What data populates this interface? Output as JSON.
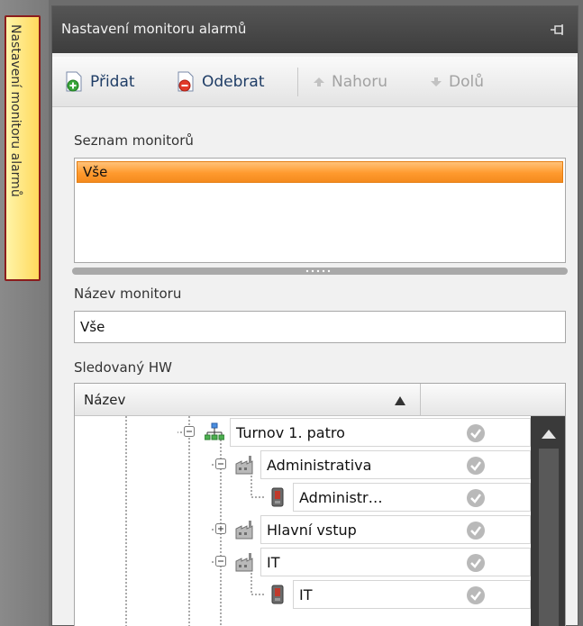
{
  "side_tab": {
    "label": "Nastavení monitoru alarmů"
  },
  "panel": {
    "title": "Nastavení monitoru alarmů",
    "pin_icon": "pin-icon"
  },
  "toolbar": {
    "add_label": "Přidat",
    "remove_label": "Odebrat",
    "up_label": "Nahoru",
    "down_label": "Dolů"
  },
  "monitor_list": {
    "label": "Seznam monitorů",
    "items": [
      "Vše"
    ],
    "selected_index": 0
  },
  "monitor_name": {
    "label": "Název monitoru",
    "value": "Vše"
  },
  "hw": {
    "label": "Sledovaný HW",
    "column_name": "Název",
    "sort": "ascending",
    "rows": [
      {
        "label": "Turnov 1. patro",
        "icon": "network-icon",
        "expander": "minus",
        "level": 0
      },
      {
        "label": "Administrativa",
        "icon": "building-icon",
        "expander": "minus",
        "level": 1
      },
      {
        "label": "Administr…",
        "icon": "reader-icon",
        "expander": "none",
        "level": 2
      },
      {
        "label": "Hlavní vstup",
        "icon": "building-icon",
        "expander": "plus",
        "level": 1
      },
      {
        "label": "IT",
        "icon": "building-icon",
        "expander": "minus",
        "level": 1
      },
      {
        "label": "IT",
        "icon": "reader-icon",
        "expander": "none",
        "level": 2
      }
    ]
  },
  "colors": {
    "selection": "#ff9a2e",
    "titlebar": "#4a4a4a",
    "tab_border": "#8b1c1c",
    "toolbar_text": "#1f3d66"
  }
}
